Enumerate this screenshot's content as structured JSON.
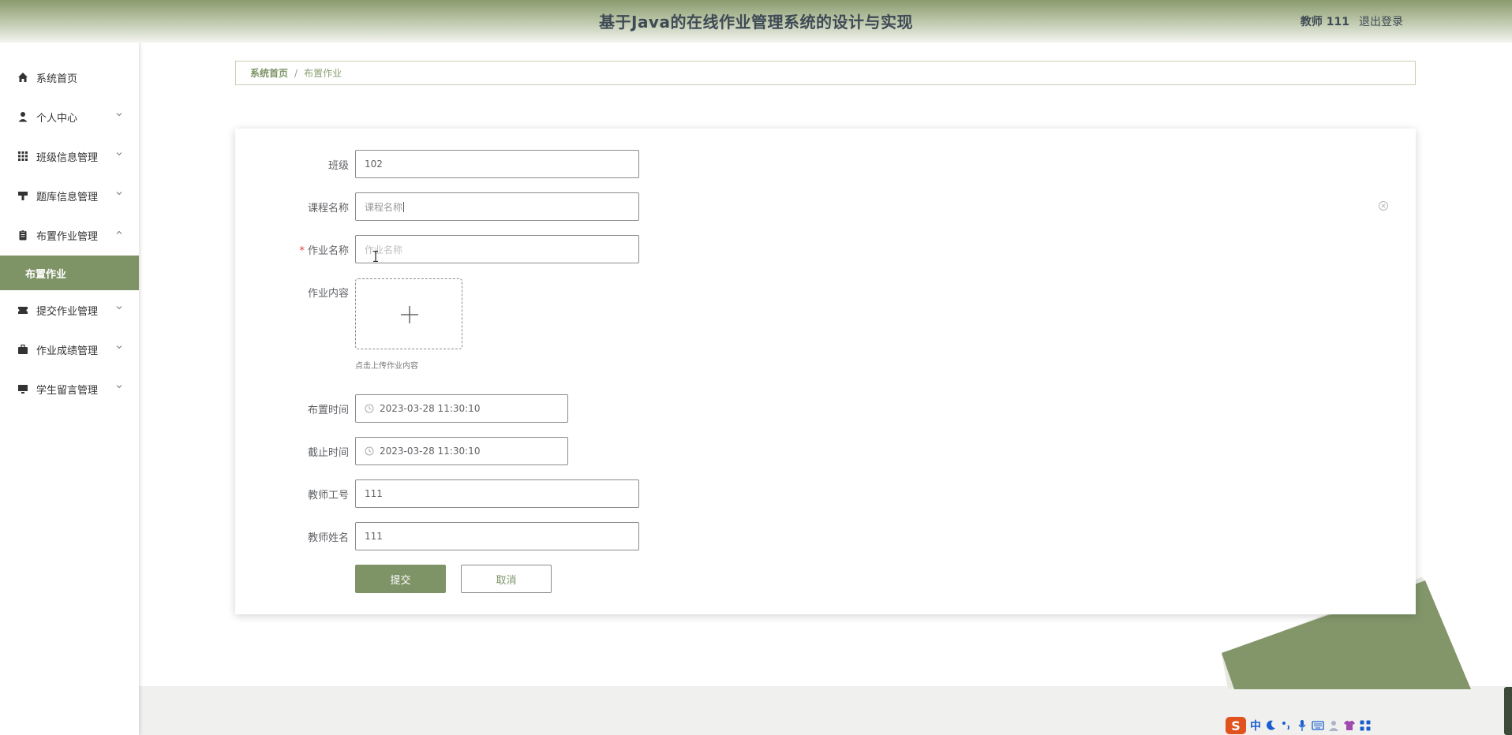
{
  "header": {
    "title": "基于Java的在线作业管理系统的设计与实现",
    "user": "教师 111",
    "logout": "退出登录"
  },
  "sidebar": {
    "items": [
      {
        "label": "系统首页",
        "icon": "home-icon"
      },
      {
        "label": "个人中心",
        "icon": "user-icon"
      },
      {
        "label": "班级信息管理",
        "icon": "grid-icon"
      },
      {
        "label": "题库信息管理",
        "icon": "stamp-icon"
      },
      {
        "label": "布置作业管理",
        "icon": "clipboard-icon"
      },
      {
        "label": "提交作业管理",
        "icon": "ticket-icon"
      },
      {
        "label": "作业成绩管理",
        "icon": "briefcase-icon"
      },
      {
        "label": "学生留言管理",
        "icon": "monitor-icon"
      }
    ],
    "active_sub": "布置作业"
  },
  "breadcrumb": {
    "home": "系统首页",
    "separator": "/",
    "current": "布置作业"
  },
  "form": {
    "class_label": "班级",
    "class_value": "102",
    "course_label": "课程名称",
    "course_placeholder": "课程名称",
    "hw_name_label": "作业名称",
    "hw_name_required": "*",
    "hw_name_placeholder": "作业名称",
    "content_label": "作业内容",
    "upload_hint": "点击上传作业内容",
    "assign_time_label": "布置时间",
    "assign_time_value": "2023-03-28 11:30:10",
    "deadline_label": "截止时间",
    "deadline_value": "2023-03-28 11:30:10",
    "teacher_id_label": "教师工号",
    "teacher_id_value": "111",
    "teacher_name_label": "教师姓名",
    "teacher_name_value": "111",
    "submit_label": "提交",
    "cancel_label": "取消"
  },
  "ime_bar": {
    "mode": "中"
  },
  "colors": {
    "accent": "#7e9366",
    "header_dark": "#8a9b6e",
    "text": "#606266"
  }
}
